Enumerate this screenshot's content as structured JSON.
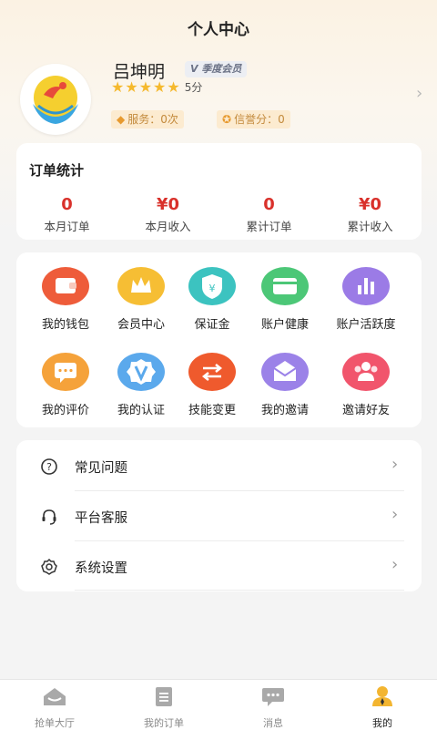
{
  "header": {
    "title": "个人中心"
  },
  "profile": {
    "name": "吕坤明",
    "vip_label": "V 季度会员",
    "rating_text": "5分",
    "stars": 5,
    "service_text": "服务：0次",
    "credit_text": "信誉分：0"
  },
  "orders": {
    "title": "订单统计",
    "stats": [
      {
        "value": "0",
        "label": "本月订单"
      },
      {
        "value": "¥0",
        "label": "本月收入"
      },
      {
        "value": "0",
        "label": "累计订单"
      },
      {
        "value": "¥0",
        "label": "累计收入"
      }
    ]
  },
  "grid": [
    {
      "label": "我的钱包",
      "icon": "wallet-icon",
      "color": "#ee5c3a"
    },
    {
      "label": "会员中心",
      "icon": "crown-icon",
      "color": "#f6be34"
    },
    {
      "label": "保证金",
      "icon": "shield-yen-icon",
      "color": "#3cc3c0"
    },
    {
      "label": "账户健康",
      "icon": "card-icon",
      "color": "#4cc777"
    },
    {
      "label": "账户活跃度",
      "icon": "bar-chart-icon",
      "color": "#9b7be6"
    },
    {
      "label": "我的评价",
      "icon": "comment-icon",
      "color": "#f5a23a"
    },
    {
      "label": "我的认证",
      "icon": "verified-v-icon",
      "color": "#5ba9ec"
    },
    {
      "label": "技能变更",
      "icon": "swap-icon",
      "color": "#ef5a2d"
    },
    {
      "label": "我的邀请",
      "icon": "mail-icon",
      "color": "#9b82e8"
    },
    {
      "label": "邀请好友",
      "icon": "friends-icon",
      "color": "#f1556c"
    }
  ],
  "menu": [
    {
      "label": "常见问题",
      "icon": "question-icon"
    },
    {
      "label": "平台客服",
      "icon": "headset-icon"
    },
    {
      "label": "系统设置",
      "icon": "settings-icon"
    }
  ],
  "tabs": [
    {
      "label": "抢单大厅",
      "icon": "hall-icon",
      "active": false
    },
    {
      "label": "我的订单",
      "icon": "orders-icon",
      "active": false
    },
    {
      "label": "消息",
      "icon": "message-icon",
      "active": false
    },
    {
      "label": "我的",
      "icon": "person-icon",
      "active": true
    }
  ]
}
